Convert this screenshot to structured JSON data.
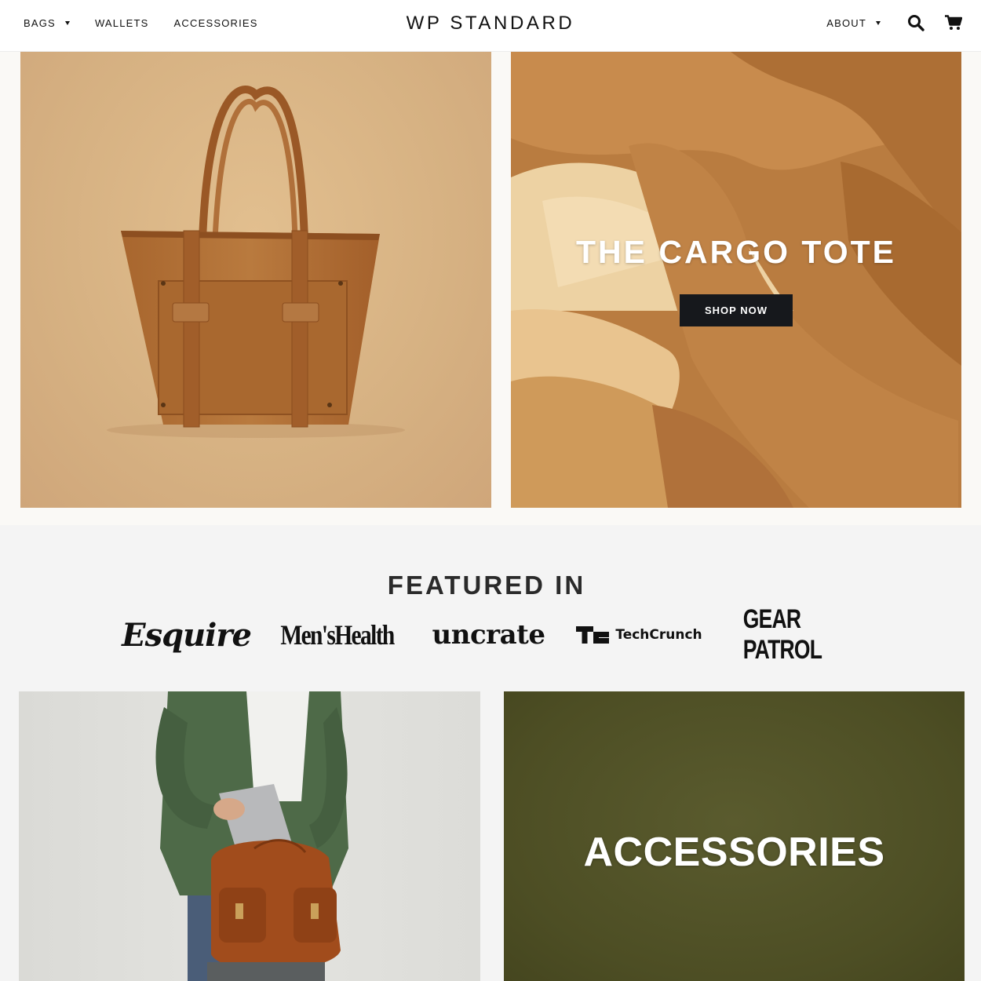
{
  "header": {
    "logo": "WP STANDARD",
    "nav_left": [
      {
        "label": "BAGS",
        "has_dropdown": true
      },
      {
        "label": "WALLETS",
        "has_dropdown": false
      },
      {
        "label": "ACCESSORIES",
        "has_dropdown": false
      }
    ],
    "nav_right": [
      {
        "label": "ABOUT",
        "has_dropdown": true
      }
    ],
    "icons": [
      "search-icon",
      "cart-icon"
    ]
  },
  "hero": {
    "left_image": "cargo-tote-bag-photo",
    "right_image": "leather-hides-photo",
    "title": "THE CARGO TOTE",
    "button_label": "SHOP NOW"
  },
  "featured": {
    "title": "FEATURED IN",
    "logos": [
      "Esquire",
      "Men'sHealth",
      "uncrate",
      "TechCrunch",
      "GEAR PATROL"
    ]
  },
  "tiles": {
    "left_image": "backpack-with-laptop-photo",
    "right_title": "ACCESSORIES"
  },
  "colors": {
    "button_bg": "#16181c",
    "accessories_bg": "#4d4e24",
    "hero_leather": "#c98f4f"
  }
}
